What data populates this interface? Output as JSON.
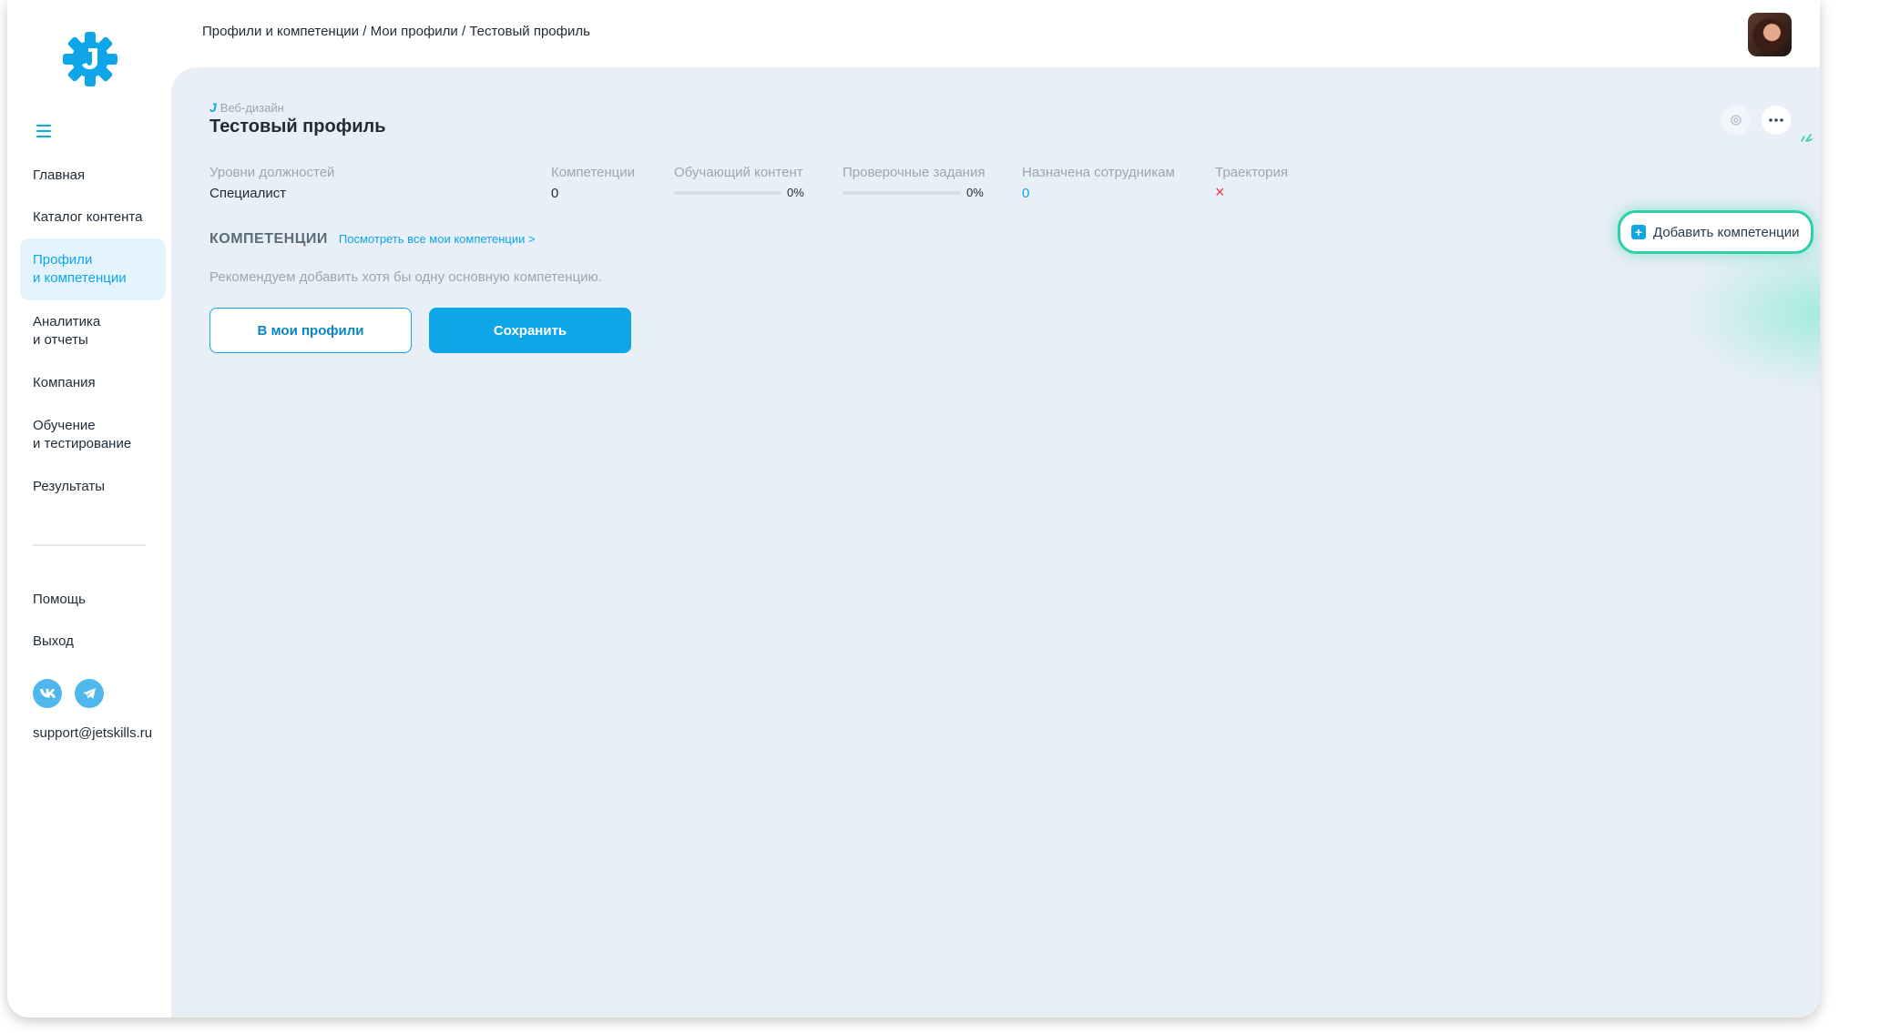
{
  "header": {
    "breadcrumb": [
      "Профили и компетенции",
      "Мои профили",
      "Тестовый профиль"
    ],
    "breadcrumb_sep": " / "
  },
  "sidebar": {
    "items": [
      {
        "label": "Главная",
        "active": false
      },
      {
        "label": "Каталог контента",
        "active": false
      },
      {
        "label": "Профили\nи компетенции",
        "active": true
      },
      {
        "label": "Аналитика\nи отчеты",
        "active": false
      },
      {
        "label": "Компания",
        "active": false
      },
      {
        "label": "Обучение\nи тестирование",
        "active": false
      },
      {
        "label": "Результаты",
        "active": false
      }
    ],
    "bottom_items": [
      {
        "label": "Помощь"
      },
      {
        "label": "Выход"
      }
    ],
    "socials": [
      "vk-icon",
      "telegram-icon"
    ],
    "support_email": "support@jetskills.ru"
  },
  "profile": {
    "tag": "Веб-дизайн",
    "title": "Тестовый профиль"
  },
  "stats": {
    "levels": {
      "label": "Уровни должностей",
      "value": "Специалист"
    },
    "competencies": {
      "label": "Компетенции",
      "value": "0"
    },
    "learning": {
      "label": "Обучающий контент",
      "percent": "0%",
      "progress": 0
    },
    "tasks": {
      "label": "Проверочные задания",
      "percent": "0%",
      "progress": 0
    },
    "assigned": {
      "label": "Назначена сотрудникам",
      "value": "0"
    },
    "trajectory": {
      "label": "Траектория",
      "value": "×"
    }
  },
  "competencies_section": {
    "title": "КОМПЕТЕНЦИИ",
    "link": "Посмотреть все мои компетенции >",
    "recommendation": "Рекомендуем добавить хотя бы одну основную компетенцию."
  },
  "buttons": {
    "to_profiles": "В мои профили",
    "save": "Сохранить",
    "add_competencies": "Добавить компетенции"
  },
  "colors": {
    "accent": "#0ea5e9",
    "background": "#e9eff6",
    "highlight": "#2fd0a8",
    "error": "#ef3b3b"
  }
}
